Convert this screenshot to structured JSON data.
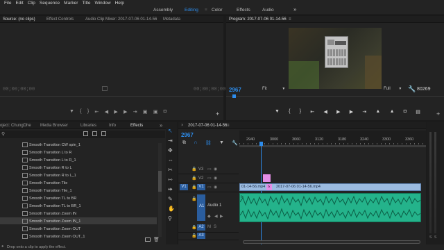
{
  "menu": [
    "File",
    "Edit",
    "Clip",
    "Sequence",
    "Marker",
    "Title",
    "Window",
    "Help"
  ],
  "workspaces": {
    "items": [
      "Assembly",
      "Editing",
      "Color",
      "Effects",
      "Audio"
    ],
    "active": "Editing",
    "more": "»",
    "divider": "≡"
  },
  "source_panel": {
    "tabs": [
      "Source: (no clips)",
      "Effect Controls",
      "Audio Clip Mixer: 2017-07-06 01-14-56",
      "Metadata"
    ],
    "menu_glyph": "≡",
    "tc_left": "00;00;00;00",
    "tc_right": "00;00;00;00"
  },
  "program_panel": {
    "title": "Program: 2017-07-06 01-14-56",
    "menu_glyph": "≡",
    "tc_left": "2967",
    "fit": "Fit",
    "quality": "Full",
    "tc_right": "80269"
  },
  "effects_panel": {
    "tabs": [
      "oject: ChungDhe",
      "Media Browser",
      "Libraries",
      "Info",
      "Effects"
    ],
    "active_tab": "Effects",
    "items": [
      "Smooth Transition CW spin_1",
      "Smooth Transition L to R",
      "Smooth Transition L to R_1",
      "Smooth Transition R to L",
      "Smooth Transition R to L_1",
      "Smooth Transition Tile",
      "Smooth Transition Tile_1",
      "Smooth Transition TL to BR",
      "Smooth Transition TL to BR_1",
      "Smooth Transition Zoom IN",
      "Smooth Transition Zoom IN_1",
      "Smooth Transition Zoom OUT",
      "Smooth Transition Zoom OUT_1"
    ],
    "selected_index": 10
  },
  "timeline": {
    "sequence_name": "2017-07-06 01-14-56",
    "timecode": "2967",
    "ruler_ticks": [
      "2940",
      "3000",
      "3060",
      "3120",
      "3180",
      "3240",
      "3300",
      "3360"
    ],
    "tracks": {
      "video": [
        "V3",
        "V2",
        "V1"
      ],
      "audio": [
        "A1",
        "A2",
        "A3"
      ],
      "v1_target": "V1",
      "a1_name": "Audio 1"
    },
    "clips": {
      "v1_left": "01-14-56.mp4",
      "v1_right": "2017-07-06 01-14-56.mp4",
      "fx_badge": "fx"
    }
  },
  "status_bar": {
    "text": "Drop onto a clip to apply the effect."
  },
  "colors": {
    "accent": "#2d8ceb",
    "video_clip": "#9bbbe0",
    "audio_clip": "#24b38b",
    "marker": "#e48ee6"
  }
}
